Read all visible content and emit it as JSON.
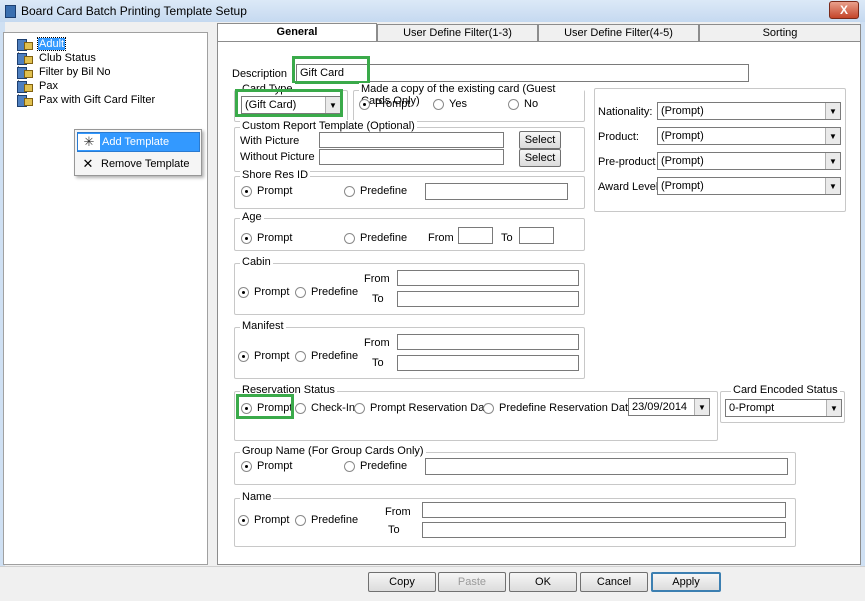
{
  "window": {
    "title": "Board Card Batch Printing Template Setup",
    "close_label": "X"
  },
  "tree": {
    "items": [
      {
        "label": "Adult",
        "selected": true
      },
      {
        "label": "Club Status"
      },
      {
        "label": "Filter by Bil No"
      },
      {
        "label": "Pax"
      },
      {
        "label": "Pax with Gift Card Filter"
      }
    ]
  },
  "context_menu": {
    "items": [
      {
        "label": "Add Template",
        "icon": "sparkle-icon",
        "glyph": "✳"
      },
      {
        "label": "Remove Template",
        "icon": "x-icon",
        "glyph": "✕"
      }
    ]
  },
  "tabs": [
    {
      "label": "General",
      "active": true
    },
    {
      "label": "User Define Filter(1-3)"
    },
    {
      "label": "User Define Filter(4-5)"
    },
    {
      "label": "Sorting"
    }
  ],
  "general": {
    "description": {
      "label": "Description",
      "value": "Gift Card"
    },
    "card_type": {
      "label": "Card Type",
      "value": "(Gift Card)"
    },
    "copy_card": {
      "label": "Made a copy of the existing card (Guest Cards Only)",
      "options": [
        "Prompt",
        "Yes",
        "No"
      ],
      "selected": "Prompt"
    },
    "custom_report": {
      "label": "Custom Report Template (Optional)",
      "with_picture_label": "With Picture",
      "with_picture_value": "",
      "without_picture_label": "Without Picture",
      "without_picture_value": "",
      "select_label": "Select"
    },
    "shore_res_id": {
      "label": "Shore Res ID",
      "options": [
        "Prompt",
        "Predefine"
      ],
      "selected": "Prompt",
      "value": ""
    },
    "age": {
      "label": "Age",
      "options": [
        "Prompt",
        "Predefine"
      ],
      "selected": "Prompt",
      "from_label": "From",
      "to_label": "To",
      "from_value": "",
      "to_value": ""
    },
    "cabin": {
      "label": "Cabin",
      "options": [
        "Prompt",
        "Predefine"
      ],
      "selected": "Prompt",
      "from_label": "From",
      "to_label": "To"
    },
    "manifest": {
      "label": "Manifest",
      "options": [
        "Prompt",
        "Predefine"
      ],
      "selected": "Prompt",
      "from_label": "From",
      "to_label": "To"
    },
    "reservation_status": {
      "label": "Reservation Status",
      "options": [
        "Prompt",
        "Check-In",
        "Prompt Reservation Date",
        "Predefine Reservation Date"
      ],
      "selected": "Prompt",
      "date": "23/09/2014"
    },
    "card_encoded_status": {
      "label": "Card Encoded Status",
      "value": "0-Prompt"
    },
    "group_name": {
      "label": "Group Name (For Group Cards Only)",
      "options": [
        "Prompt",
        "Predefine"
      ],
      "selected": "Prompt"
    },
    "name": {
      "label": "Name",
      "options": [
        "Prompt",
        "Predefine"
      ],
      "selected": "Prompt",
      "from_label": "From",
      "to_label": "To"
    },
    "right_filters": [
      {
        "label": "Nationality:",
        "value": "(Prompt)"
      },
      {
        "label": "Product:",
        "value": "(Prompt)"
      },
      {
        "label": "Pre-product",
        "value": "(Prompt)"
      },
      {
        "label": "Award Level:",
        "value": "(Prompt)"
      }
    ]
  },
  "buttons": {
    "copy": "Copy",
    "paste": "Paste",
    "ok": "OK",
    "cancel": "Cancel",
    "apply": "Apply"
  },
  "arrow_glyph": "▼"
}
